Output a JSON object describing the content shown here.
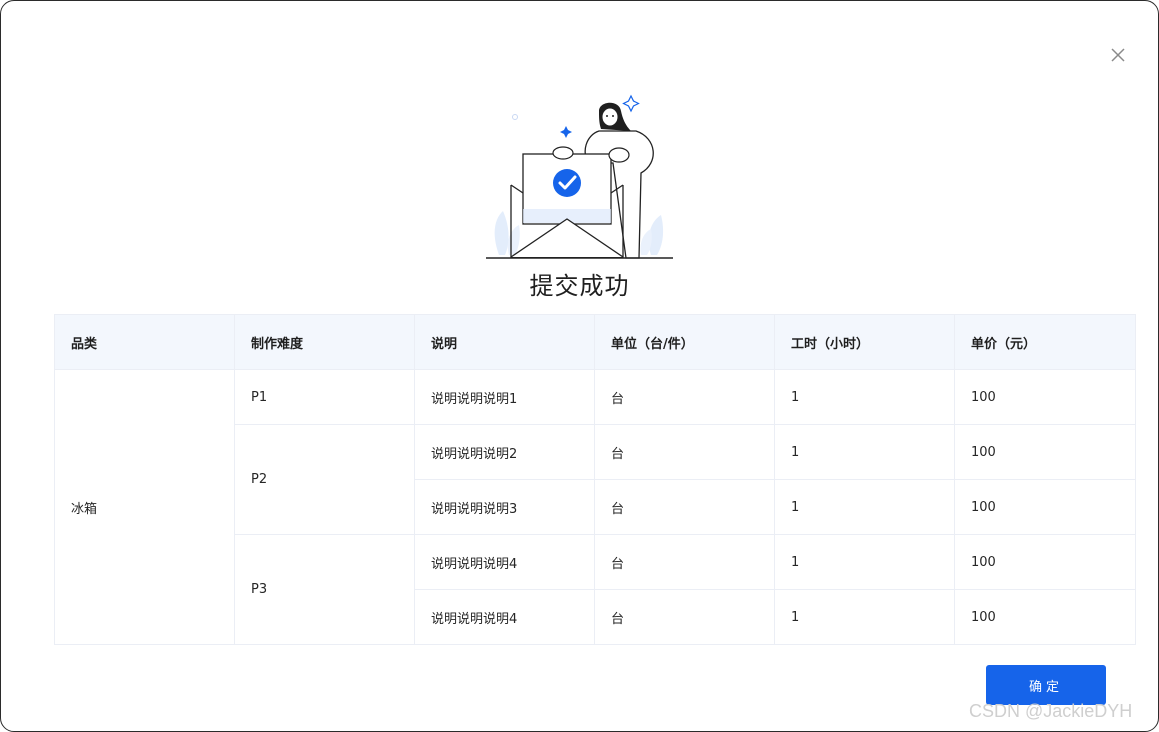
{
  "dialog": {
    "title": "提交成功",
    "ok_label": "确定",
    "close_icon": "close-icon",
    "illustration_icon": "success-envelope-illustration"
  },
  "table": {
    "headers": [
      "品类",
      "制作难度",
      "说明",
      "单位（台/件）",
      "工时（小时）",
      "单价（元）"
    ],
    "category": "冰箱",
    "groups": [
      {
        "difficulty": "P1",
        "rows": [
          {
            "desc": "说明说明说明1",
            "unit": "台",
            "hours": "1",
            "price": "100"
          }
        ]
      },
      {
        "difficulty": "P2",
        "rows": [
          {
            "desc": "说明说明说明2",
            "unit": "台",
            "hours": "1",
            "price": "100"
          },
          {
            "desc": "说明说明说明3",
            "unit": "台",
            "hours": "1",
            "price": "100"
          }
        ]
      },
      {
        "difficulty": "P3",
        "rows": [
          {
            "desc": "说明说明说明4",
            "unit": "台",
            "hours": "1",
            "price": "100"
          },
          {
            "desc": "说明说明说明4",
            "unit": "台",
            "hours": "1",
            "price": "100"
          }
        ]
      }
    ]
  },
  "watermark": "CSDN @JackieDYH",
  "colors": {
    "primary": "#1664ea",
    "header_bg": "#f3f7fd",
    "border": "#ebeef5"
  }
}
